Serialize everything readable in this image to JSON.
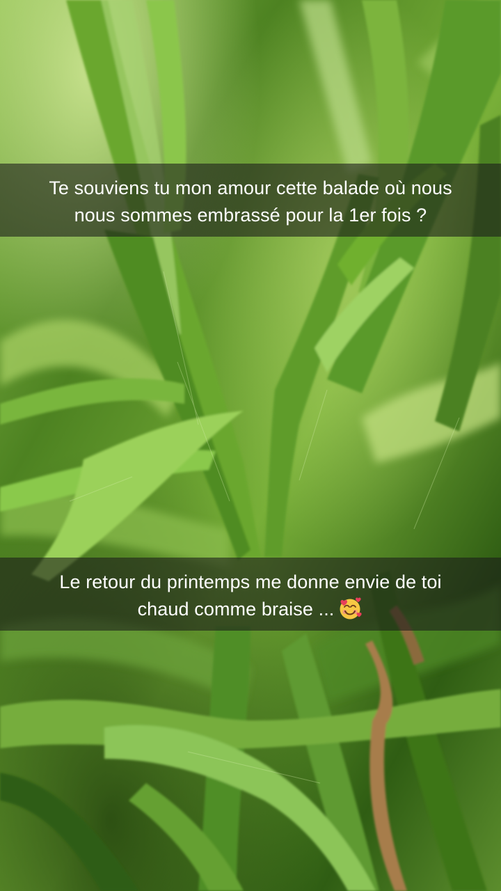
{
  "photo": {
    "subject": "close-up-grass-blades"
  },
  "captions": {
    "top": {
      "line1": "Te souviens tu mon amour cette balade où nous",
      "line2": "nous sommes embrassé pour la 1er fois ?"
    },
    "bottom": {
      "line1": "Le retour du printemps me donne envie de toi",
      "line2": "chaud comme braise ...",
      "emoji": "smiling-face-with-hearts-icon"
    }
  },
  "colors": {
    "caption_background": "#191919",
    "caption_text": "#ffffff",
    "grass_dark": "#2f5d13",
    "grass_mid": "#5f9627",
    "grass_light": "#b8d985"
  }
}
